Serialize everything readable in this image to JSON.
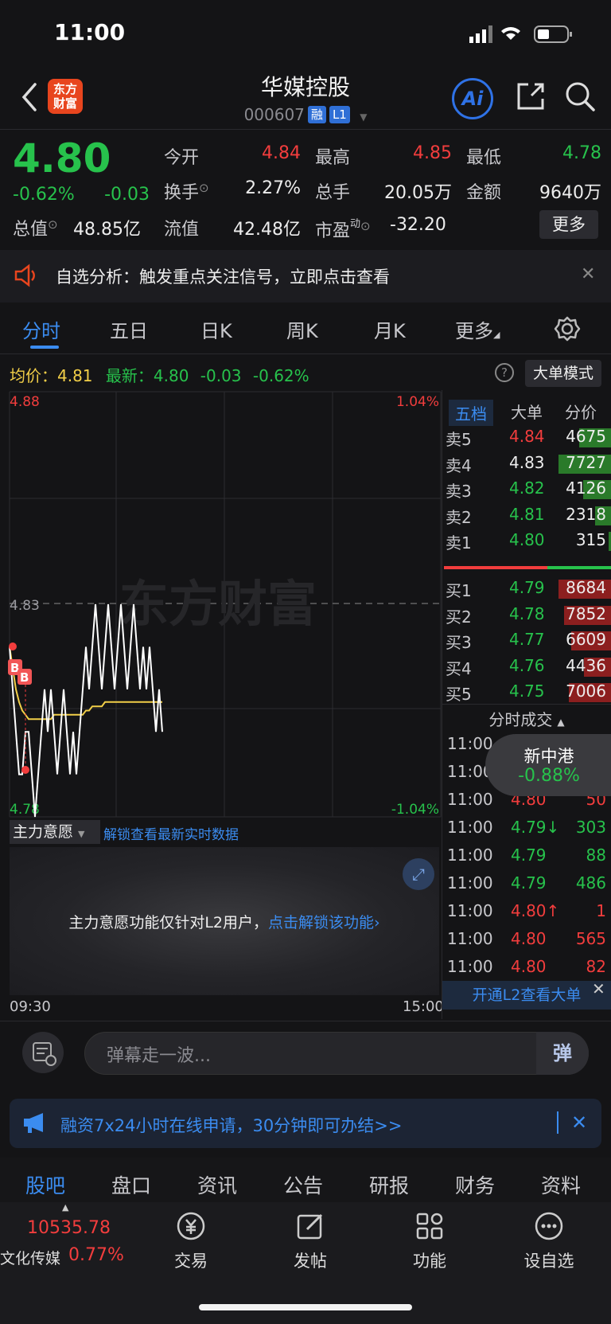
{
  "status": {
    "time": "11:00"
  },
  "header": {
    "logo_text_1": "东方",
    "logo_text_2": "财富",
    "stock_name": "华媒控股",
    "stock_code": "000607",
    "tag_rong": "融",
    "tag_l1": "L1",
    "ai_label": "Ai"
  },
  "quote": {
    "price": "4.80",
    "pct": "-0.62%",
    "change": "-0.03",
    "open_label": "今开",
    "open": "4.84",
    "high_label": "最高",
    "high": "4.85",
    "low_label": "最低",
    "low": "4.78",
    "turnover_label": "换手",
    "turnover": "2.27%",
    "volume_label": "总手",
    "volume": "20.05万",
    "amount_label": "金额",
    "amount": "9640万",
    "mktcap_label": "总值",
    "mktcap": "48.85亿",
    "float_label": "流值",
    "float": "42.48亿",
    "pe_label": "市盈",
    "pe_sup": "动",
    "pe": "-32.20",
    "more": "更多"
  },
  "notice": {
    "text": "自选分析：触发重点关注信号，立即点击查看"
  },
  "chart_tabs": [
    "分时",
    "五日",
    "日K",
    "周K",
    "月K",
    "更多"
  ],
  "info": {
    "avg_label": "均价：",
    "avg": "4.81",
    "latest_label": "最新：",
    "latest": "4.80",
    "chg": "-0.03",
    "pct": "-0.62%",
    "big_order_mode": "大单模式",
    "help": "?"
  },
  "chart": {
    "y_top": "4.88",
    "y_bottom": "4.78",
    "pct_top": "1.04%",
    "pct_bottom": "-1.04%",
    "prev_close": "4.83",
    "watermark": "东方财富",
    "time_start": "09:30",
    "time_end": "15:00",
    "mode_select": "主力意愿",
    "unlock_link": "解锁查看最新实时数据",
    "l2_msg_1": "主力意愿功能仅针对L2用户，",
    "l2_msg_2": "点击解锁该功能",
    "marker_b1": "B",
    "marker_b2": "B"
  },
  "chart_data": {
    "type": "line",
    "ylim": [
      4.78,
      4.88
    ],
    "prev_close": 4.83,
    "series": [
      {
        "values": [
          4.82,
          4.81,
          4.8,
          4.79,
          4.79,
          4.8,
          4.8,
          4.79,
          4.78,
          4.79,
          4.8,
          4.81,
          4.8,
          4.81,
          4.8,
          4.79,
          4.8,
          4.81,
          4.8,
          4.79,
          4.8,
          4.79,
          4.8,
          4.81,
          4.82,
          4.81,
          4.82,
          4.83,
          4.82,
          4.81,
          4.82,
          4.83,
          4.82,
          4.81,
          4.82,
          4.83,
          4.82,
          4.81,
          4.82,
          4.83,
          4.82,
          4.81,
          4.82,
          4.81,
          4.82,
          4.81,
          4.8,
          4.81,
          4.8
        ]
      },
      {
        "values": [
          4.82,
          4.815,
          4.81,
          4.807,
          4.805,
          4.804,
          4.803,
          4.803,
          4.803,
          4.803,
          4.803,
          4.803,
          4.803,
          4.803,
          4.804,
          4.804,
          4.804,
          4.804,
          4.804,
          4.804,
          4.804,
          4.804,
          4.804,
          4.804,
          4.805,
          4.805,
          4.806,
          4.806,
          4.806,
          4.806,
          4.807,
          4.807,
          4.807,
          4.807,
          4.807,
          4.807,
          4.807,
          4.807,
          4.807,
          4.807,
          4.807,
          4.807,
          4.807,
          4.807,
          4.807,
          4.807,
          4.807,
          4.807,
          4.807
        ]
      }
    ],
    "colors": {
      "price": "#ffffff",
      "avg": "#f2cf48",
      "up": "#f23d3d",
      "down": "#27c24c"
    }
  },
  "orderbook": {
    "tabs": [
      "五档",
      "大单",
      "分价"
    ],
    "asks": [
      {
        "label": "卖5",
        "price": "4.84",
        "vol": "4675",
        "bar": 0.61
      },
      {
        "label": "卖4",
        "price": "4.83",
        "vol": "7727",
        "bar": 1.0
      },
      {
        "label": "卖3",
        "price": "4.82",
        "vol": "4126",
        "bar": 0.53
      },
      {
        "label": "卖2",
        "price": "4.81",
        "vol": "2318",
        "bar": 0.3
      },
      {
        "label": "卖1",
        "price": "4.80",
        "vol": "315",
        "bar": 0.04
      }
    ],
    "bids": [
      {
        "label": "买1",
        "price": "4.79",
        "vol": "8684",
        "bar": 1.0
      },
      {
        "label": "买2",
        "price": "4.78",
        "vol": "7852",
        "bar": 0.9
      },
      {
        "label": "买3",
        "price": "4.77",
        "vol": "6609",
        "bar": 0.76
      },
      {
        "label": "买4",
        "price": "4.76",
        "vol": "4436",
        "bar": 0.51
      },
      {
        "label": "买5",
        "price": "4.75",
        "vol": "7006",
        "bar": 0.81
      }
    ],
    "trades_title": "分时成交",
    "trades": [
      {
        "time": "11:00",
        "price": "",
        "vol": "",
        "dir": ""
      },
      {
        "time": "11:00",
        "price": "",
        "vol": "",
        "dir": ""
      },
      {
        "time": "11:00",
        "price": "4.80",
        "vol": "50",
        "dir": "red"
      },
      {
        "time": "11:00",
        "price": "4.79↓",
        "vol": "303",
        "dir": "green"
      },
      {
        "time": "11:00",
        "price": "4.79",
        "vol": "88",
        "dir": "green"
      },
      {
        "time": "11:00",
        "price": "4.79",
        "vol": "486",
        "dir": "green"
      },
      {
        "time": "11:00",
        "price": "4.80↑",
        "vol": "1",
        "dir": "red"
      },
      {
        "time": "11:00",
        "price": "4.80",
        "vol": "565",
        "dir": "red"
      },
      {
        "time": "11:00",
        "price": "4.80",
        "vol": "82",
        "dir": "red"
      }
    ],
    "popup_name": "新中港",
    "popup_pct": "-0.88%",
    "l2_open": "开通L2查看大单"
  },
  "danmu": {
    "placeholder": "弹幕走一波...",
    "send": "弹"
  },
  "promo": {
    "text": "融资7x24小时在线申请，30分钟即可办结>>"
  },
  "bottom_tabs": [
    "股吧",
    "盘口",
    "资讯",
    "公告",
    "研报",
    "财务",
    "资料"
  ],
  "bottom_bar": {
    "index_val": "10535.78",
    "index_name": "文化传媒",
    "index_pct": "0.77%",
    "nav": [
      "交易",
      "发帖",
      "功能",
      "设自选"
    ]
  }
}
